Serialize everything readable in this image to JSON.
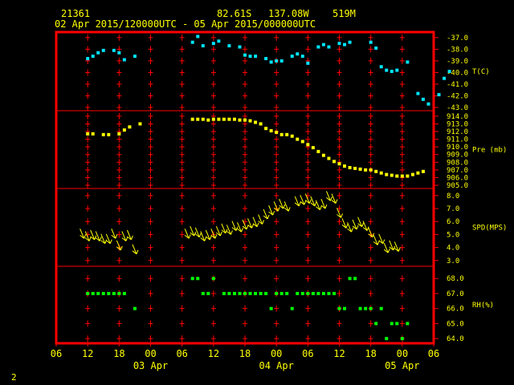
{
  "header": {
    "station_id": "21361",
    "latitude": "82.61S",
    "longitude": "137.08W",
    "elevation": "519M",
    "period": "02 Apr 2015/120000UTC - 05 Apr 2015/000000UTC"
  },
  "footer": {
    "page_number": "2"
  },
  "colors": {
    "background": "#000000",
    "frame": "#ff0000",
    "grid_marks": "#ff0000",
    "text": "#ffff00",
    "temperature": "#00e5ff",
    "pressure": "#ffff00",
    "wind": "#ffff00",
    "humidity": "#00ff00"
  },
  "chart_data": {
    "type": "scatter",
    "x_axis": {
      "unit": "hours from 02 Apr 06 UTC",
      "range": [
        0,
        72
      ],
      "ticks": [
        {
          "x": 0,
          "label": "06"
        },
        {
          "x": 6,
          "label": "12"
        },
        {
          "x": 12,
          "label": "18"
        },
        {
          "x": 18,
          "label": "00"
        },
        {
          "x": 24,
          "label": "06"
        },
        {
          "x": 30,
          "label": "12"
        },
        {
          "x": 36,
          "label": "18"
        },
        {
          "x": 42,
          "label": "00"
        },
        {
          "x": 48,
          "label": "06"
        },
        {
          "x": 54,
          "label": "12"
        },
        {
          "x": 60,
          "label": "18"
        },
        {
          "x": 66,
          "label": "00"
        },
        {
          "x": 72,
          "label": "06"
        }
      ],
      "day_labels": [
        {
          "x": 18,
          "label": "03 Apr"
        },
        {
          "x": 42,
          "label": "04 Apr"
        },
        {
          "x": 66,
          "label": "05 Apr"
        }
      ]
    },
    "panels": [
      {
        "id": "temperature",
        "label": "T(C)",
        "ylim": [
          -43,
          -36.8
        ],
        "ticks": [
          -37.0,
          -38.0,
          -39.0,
          -40.0,
          -41.0,
          -42.0,
          -43.0
        ],
        "tick_labels": [
          "-37.0",
          "-38.0",
          "-39.0",
          "-40.0",
          "-41.0",
          "-42.0",
          "-43.0"
        ],
        "marker": "square",
        "points": [
          [
            6,
            -38.8
          ],
          [
            7,
            -38.6
          ],
          [
            8,
            -38.3
          ],
          [
            9,
            -38.1
          ],
          [
            11,
            -38.1
          ],
          [
            12,
            -38.3
          ],
          [
            13,
            -38.9
          ],
          [
            15,
            -38.6
          ],
          [
            26,
            -37.4
          ],
          [
            27,
            -36.9
          ],
          [
            28,
            -37.7
          ],
          [
            30,
            -37.5
          ],
          [
            31,
            -37.3
          ],
          [
            33,
            -37.7
          ],
          [
            35,
            -37.8
          ],
          [
            36,
            -38.5
          ],
          [
            37,
            -38.6
          ],
          [
            38,
            -38.6
          ],
          [
            40,
            -38.8
          ],
          [
            41,
            -39.1
          ],
          [
            42,
            -39.0
          ],
          [
            43,
            -39.0
          ],
          [
            45,
            -38.6
          ],
          [
            46,
            -38.4
          ],
          [
            47,
            -38.6
          ],
          [
            48,
            -39.2
          ],
          [
            50,
            -37.8
          ],
          [
            51,
            -37.6
          ],
          [
            52,
            -37.8
          ],
          [
            54,
            -37.5
          ],
          [
            55,
            -37.6
          ],
          [
            56,
            -37.4
          ],
          [
            60,
            -37.4
          ],
          [
            61,
            -37.9
          ],
          [
            62,
            -39.5
          ],
          [
            63,
            -39.8
          ],
          [
            64,
            -39.9
          ],
          [
            65,
            -39.8
          ],
          [
            67,
            -39.1
          ],
          [
            69,
            -41.8
          ],
          [
            70,
            -42.3
          ],
          [
            71,
            -42.7
          ],
          [
            73,
            -41.9
          ],
          [
            74,
            -40.5
          ],
          [
            75,
            -39.9
          ]
        ]
      },
      {
        "id": "pressure",
        "label": "Pre (mb)",
        "ylim": [
          905,
          914.3
        ],
        "ticks": [
          914,
          913,
          912,
          911,
          910,
          909,
          908,
          907,
          906,
          905
        ],
        "tick_labels": [
          "914.0",
          "913.0",
          "912.0",
          "911.0",
          "910.0",
          "909.0",
          "908.0",
          "907.0",
          "906.0",
          "905.0"
        ],
        "marker": "square",
        "points": [
          [
            6,
            911.7
          ],
          [
            7,
            911.7
          ],
          [
            9,
            911.6
          ],
          [
            10,
            911.6
          ],
          [
            12,
            911.7
          ],
          [
            13,
            912.2
          ],
          [
            14,
            912.6
          ],
          [
            16,
            913.0
          ],
          [
            26,
            913.6
          ],
          [
            27,
            913.6
          ],
          [
            28,
            913.6
          ],
          [
            29,
            913.5
          ],
          [
            30,
            913.6
          ],
          [
            31,
            913.6
          ],
          [
            32,
            913.6
          ],
          [
            33,
            913.6
          ],
          [
            34,
            913.6
          ],
          [
            35,
            913.5
          ],
          [
            36,
            913.5
          ],
          [
            37,
            913.4
          ],
          [
            38,
            913.2
          ],
          [
            39,
            913.0
          ],
          [
            40,
            912.4
          ],
          [
            41,
            912.1
          ],
          [
            42,
            911.9
          ],
          [
            43,
            911.6
          ],
          [
            44,
            911.6
          ],
          [
            45,
            911.4
          ],
          [
            46,
            911.0
          ],
          [
            47,
            910.7
          ],
          [
            48,
            910.3
          ],
          [
            49,
            909.9
          ],
          [
            50,
            909.4
          ],
          [
            51,
            908.9
          ],
          [
            52,
            908.5
          ],
          [
            53,
            908.1
          ],
          [
            54,
            907.8
          ],
          [
            55,
            907.5
          ],
          [
            56,
            907.3
          ],
          [
            57,
            907.2
          ],
          [
            58,
            907.1
          ],
          [
            59,
            907.0
          ],
          [
            60,
            907.0
          ],
          [
            61,
            906.8
          ],
          [
            62,
            906.6
          ],
          [
            63,
            906.4
          ],
          [
            64,
            906.3
          ],
          [
            65,
            906.2
          ],
          [
            66,
            906.2
          ],
          [
            67,
            906.2
          ],
          [
            68,
            906.4
          ],
          [
            69,
            906.6
          ],
          [
            70,
            906.8
          ]
        ]
      },
      {
        "id": "wind",
        "label": "SPD(MPS)",
        "ylim": [
          2.8,
          8.3
        ],
        "ticks": [
          8,
          7,
          6,
          5,
          4,
          3
        ],
        "tick_labels": [
          "8.0",
          "7.0",
          "6.0",
          "5.0",
          "4.0",
          "3.0"
        ],
        "marker": "arrow",
        "points": [
          [
            5,
            4.7
          ],
          [
            6,
            4.5
          ],
          [
            7,
            4.6
          ],
          [
            8,
            4.5
          ],
          [
            9,
            4.3
          ],
          [
            10,
            4.3
          ],
          [
            11,
            4.7
          ],
          [
            12,
            3.8
          ],
          [
            13,
            4.5
          ],
          [
            14,
            4.6
          ],
          [
            15,
            3.5
          ],
          [
            25,
            4.7
          ],
          [
            26,
            4.9
          ],
          [
            27,
            4.8
          ],
          [
            28,
            4.5
          ],
          [
            29,
            4.6
          ],
          [
            30,
            4.7
          ],
          [
            31,
            4.9
          ],
          [
            32,
            5.1
          ],
          [
            33,
            5.0
          ],
          [
            34,
            5.3
          ],
          [
            35,
            5.2
          ],
          [
            36,
            5.4
          ],
          [
            37,
            5.5
          ],
          [
            38,
            5.6
          ],
          [
            39,
            5.8
          ],
          [
            40,
            6.2
          ],
          [
            41,
            6.5
          ],
          [
            42,
            6.8
          ],
          [
            43,
            7.0
          ],
          [
            44,
            6.8
          ],
          [
            46,
            7.2
          ],
          [
            47,
            7.3
          ],
          [
            48,
            7.4
          ],
          [
            49,
            7.2
          ],
          [
            50,
            6.9
          ],
          [
            51,
            7.0
          ],
          [
            52,
            7.6
          ],
          [
            53,
            7.4
          ],
          [
            54,
            6.3
          ],
          [
            55,
            5.5
          ],
          [
            56,
            5.2
          ],
          [
            57,
            5.4
          ],
          [
            58,
            5.6
          ],
          [
            59,
            5.3
          ],
          [
            60,
            4.8
          ],
          [
            61,
            4.2
          ],
          [
            62,
            4.3
          ],
          [
            63,
            3.6
          ],
          [
            64,
            3.8
          ],
          [
            65,
            3.7
          ]
        ]
      },
      {
        "id": "humidity",
        "label": "RH(%)",
        "ylim": [
          63.9,
          68.6
        ],
        "ticks": [
          68,
          67,
          66,
          65,
          64
        ],
        "tick_labels": [
          "68.0",
          "67.0",
          "66.0",
          "65.0",
          "64.0"
        ],
        "marker": "square",
        "points": [
          [
            6,
            67
          ],
          [
            7,
            67
          ],
          [
            8,
            67
          ],
          [
            9,
            67
          ],
          [
            10,
            67
          ],
          [
            11,
            67
          ],
          [
            12,
            67
          ],
          [
            13,
            67
          ],
          [
            15,
            66
          ],
          [
            26,
            68
          ],
          [
            27,
            68
          ],
          [
            28,
            67
          ],
          [
            29,
            67
          ],
          [
            30,
            68
          ],
          [
            32,
            67
          ],
          [
            33,
            67
          ],
          [
            34,
            67
          ],
          [
            35,
            67
          ],
          [
            36,
            67
          ],
          [
            37,
            67
          ],
          [
            38,
            67
          ],
          [
            39,
            67
          ],
          [
            40,
            67
          ],
          [
            41,
            66
          ],
          [
            42,
            67
          ],
          [
            43,
            67
          ],
          [
            44,
            67
          ],
          [
            45,
            66
          ],
          [
            46,
            67
          ],
          [
            47,
            67
          ],
          [
            48,
            67
          ],
          [
            49,
            67
          ],
          [
            50,
            67
          ],
          [
            51,
            67
          ],
          [
            52,
            67
          ],
          [
            53,
            67
          ],
          [
            54,
            66
          ],
          [
            55,
            66
          ],
          [
            56,
            68
          ],
          [
            57,
            68
          ],
          [
            58,
            66
          ],
          [
            59,
            66
          ],
          [
            60,
            66
          ],
          [
            61,
            65
          ],
          [
            62,
            66
          ],
          [
            63,
            64
          ],
          [
            64,
            65
          ],
          [
            65,
            65
          ],
          [
            66,
            64
          ],
          [
            67,
            65
          ]
        ]
      }
    ]
  }
}
